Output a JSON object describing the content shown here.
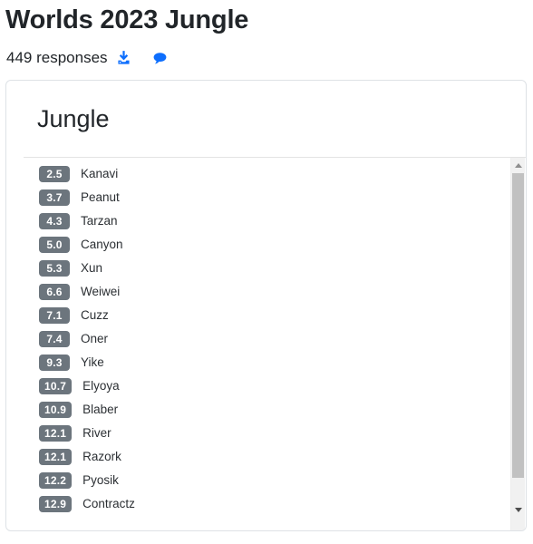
{
  "header": {
    "title": "Worlds 2023 Jungle",
    "responses_text": "449 responses",
    "download_icon": "download-icon",
    "comment_icon": "comment-bubble-icon",
    "icon_color": "#0d6efd"
  },
  "card": {
    "heading": "Jungle",
    "badge_bg": "#6c757d",
    "badge_fg": "#ffffff",
    "border_color": "#dee2e6",
    "rows": [
      {
        "value": "2.5",
        "name": "Kanavi"
      },
      {
        "value": "3.7",
        "name": "Peanut"
      },
      {
        "value": "4.3",
        "name": "Tarzan"
      },
      {
        "value": "5.0",
        "name": "Canyon"
      },
      {
        "value": "5.3",
        "name": "Xun"
      },
      {
        "value": "6.6",
        "name": "Weiwei"
      },
      {
        "value": "7.1",
        "name": "Cuzz"
      },
      {
        "value": "7.4",
        "name": "Oner"
      },
      {
        "value": "9.3",
        "name": "Yike"
      },
      {
        "value": "10.7",
        "name": "Elyoya"
      },
      {
        "value": "10.9",
        "name": "Blaber"
      },
      {
        "value": "12.1",
        "name": "River"
      },
      {
        "value": "12.1",
        "name": "Razork"
      },
      {
        "value": "12.2",
        "name": "Pyosik"
      },
      {
        "value": "12.9",
        "name": "Contractz"
      }
    ]
  },
  "scrollbar": {
    "up_arrow": "scroll-up-arrow-icon",
    "down_arrow": "scroll-down-arrow-icon",
    "thumb": "scrollbar-thumb"
  }
}
